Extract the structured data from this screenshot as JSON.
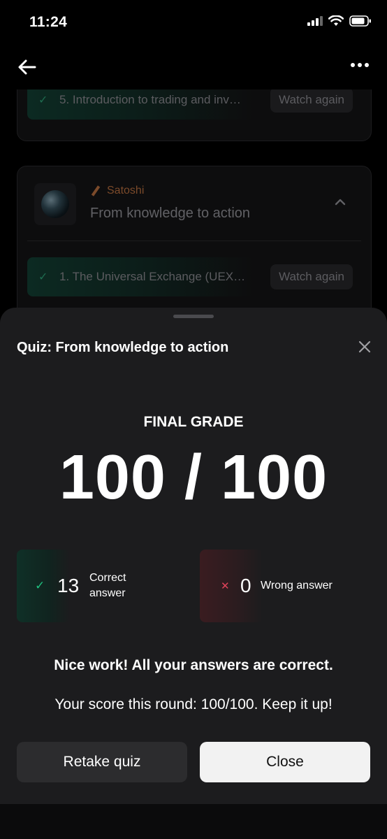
{
  "status_bar": {
    "time": "11:24"
  },
  "background": {
    "card1": {
      "lesson": {
        "title": "5. Introduction to trading and inv…",
        "action": "Watch again"
      }
    },
    "card2": {
      "tag": "Satoshi",
      "title": "From knowledge to action",
      "lesson": {
        "title": "1. The Universal Exchange (UEX…",
        "action": "Watch again"
      }
    }
  },
  "quiz": {
    "title": "Quiz: From knowledge to action",
    "grade_label": "FINAL GRADE",
    "grade_value": "100 / 100",
    "correct": {
      "count": "13",
      "label": "Correct answer"
    },
    "wrong": {
      "count": "0",
      "label": "Wrong answer"
    },
    "message_title": "Nice work! All your answers are correct.",
    "message_sub": "Your score this round: 100/100. Keep it up!",
    "retake_label": "Retake quiz",
    "close_label": "Close"
  },
  "colors": {
    "correct": "#1fbf7e",
    "wrong": "#e0435a"
  }
}
